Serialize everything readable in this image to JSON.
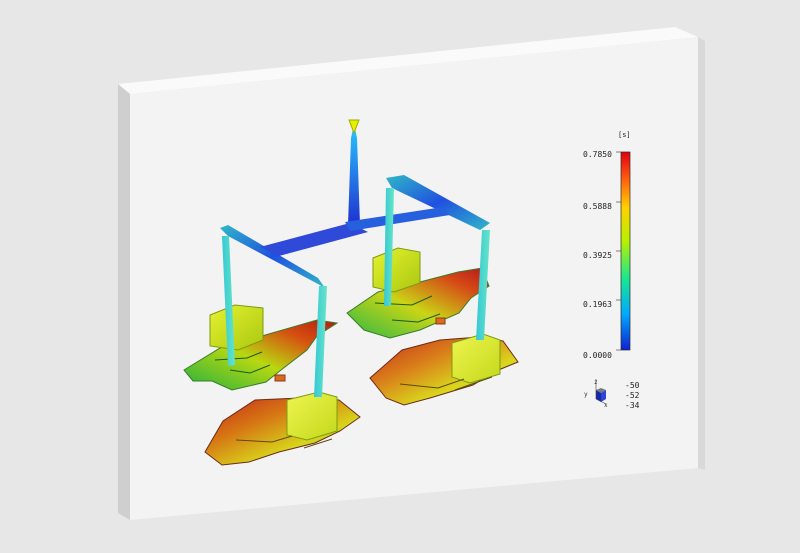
{
  "legend": {
    "unit": "[s]",
    "max_label": "0.7850",
    "ticks": [
      "0.7850",
      "0.5888",
      "0.3925",
      "0.1963",
      "0.0000"
    ],
    "colors": [
      "#1020d0",
      "#00a8ff",
      "#18e890",
      "#b8f000",
      "#ffd000",
      "#ff6010",
      "#e00010"
    ]
  },
  "orientation": {
    "axis_labels": [
      "z",
      "y",
      "x"
    ],
    "angles": [
      "-50",
      "-52",
      "-34"
    ]
  },
  "model": {
    "description_icon": "mold-fill-simulation",
    "gradient_colors": {
      "sprue": "#2a3ed8",
      "runner": "#3a6ee0",
      "drop": "#50d0d8",
      "part_low": "#30c050",
      "part_mid": "#e0e020",
      "part_high": "#d02020"
    }
  }
}
